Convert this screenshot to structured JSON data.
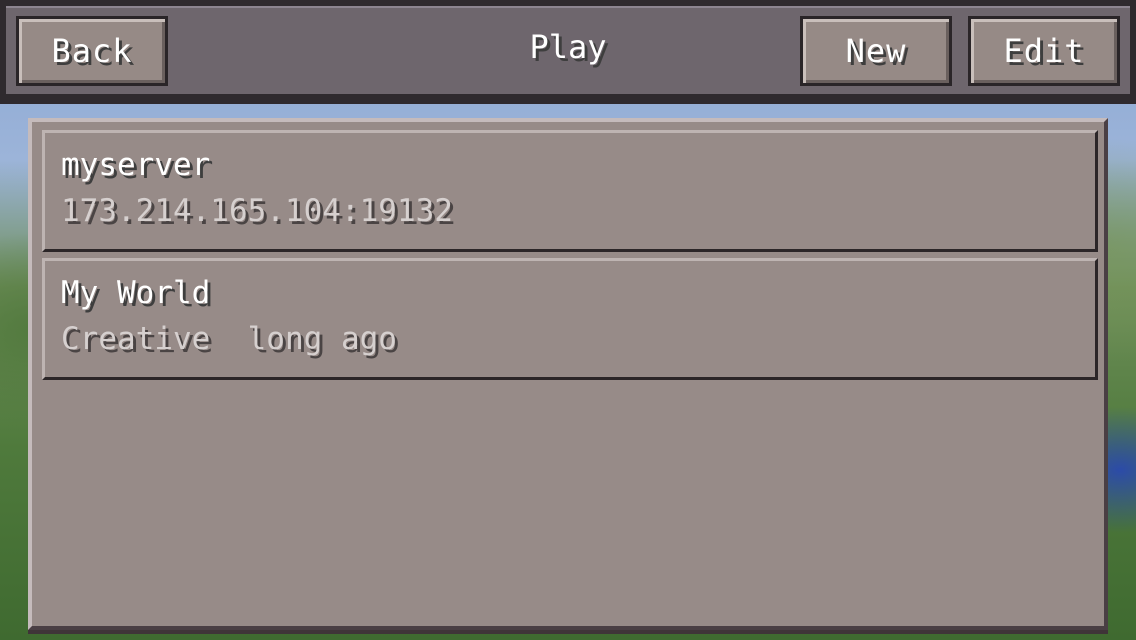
{
  "header": {
    "title": "Play",
    "back_label": "Back",
    "new_label": "New",
    "edit_label": "Edit"
  },
  "worlds": [
    {
      "name": "myserver",
      "detail": "173.214.165.104:19132"
    },
    {
      "name": "My World",
      "detail": "Creative  long ago"
    }
  ]
}
